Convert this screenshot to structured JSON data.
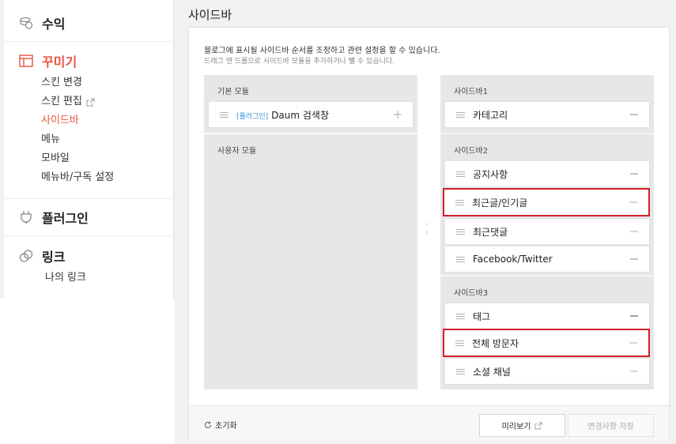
{
  "nav": {
    "revenue": {
      "label": "수익",
      "icon": "coin-stack-icon"
    },
    "decorate": {
      "label": "꾸미기",
      "icon": "layout-icon",
      "items": [
        {
          "label": "스킨 변경"
        },
        {
          "label": "스킨 편집",
          "icon": "external-link-icon"
        },
        {
          "label": "사이드바",
          "active": true
        },
        {
          "label": "메뉴"
        },
        {
          "label": "모바일"
        },
        {
          "label": "메뉴바/구독 설정"
        }
      ]
    },
    "plugin": {
      "label": "플러그인",
      "icon": "plug-icon"
    },
    "link": {
      "label": "링크",
      "icon": "chain-link-icon",
      "items": [
        {
          "label": "나의 링크"
        }
      ]
    }
  },
  "main": {
    "title": "사이드바",
    "desc1": "블로그에 표시될 사이드바 순서를 조정하고 관련 설정을 할 수 있습니다.",
    "desc2": "드래그 앤 드롭으로 사이드바 모듈을 추가하거나 뺄 수 있습니다.",
    "left": {
      "basic_label": "기본 모듈",
      "basic_items": [
        {
          "tag": "[플러그인]",
          "name": "Daum 검색창",
          "action": "+"
        }
      ],
      "user_label": "사용자 모듈"
    },
    "sidebars": [
      {
        "label": "사이드바1",
        "items": [
          {
            "name": "카테고리",
            "action": "−"
          }
        ]
      },
      {
        "label": "사이드바2",
        "items": [
          {
            "name": "공지사항",
            "action": "−"
          },
          {
            "name": "최근글/인기글",
            "action": "−",
            "highlighted": true
          },
          {
            "name": "최근댓글",
            "action": "−"
          },
          {
            "name": "Facebook/Twitter",
            "action": "−"
          }
        ]
      },
      {
        "label": "사이드바3",
        "items": [
          {
            "name": "태그",
            "action": "−"
          },
          {
            "name": "전체 방문자",
            "action": "−",
            "highlighted": true
          },
          {
            "name": "소셜 채널",
            "action": "−"
          }
        ]
      }
    ],
    "footer": {
      "reset": "초기화",
      "preview": "미리보기",
      "save": "변경사항 저장"
    }
  },
  "colors": {
    "accent": "#e9533f",
    "highlight": "#d0202a",
    "plugin_tag": "#3a8fd0"
  }
}
